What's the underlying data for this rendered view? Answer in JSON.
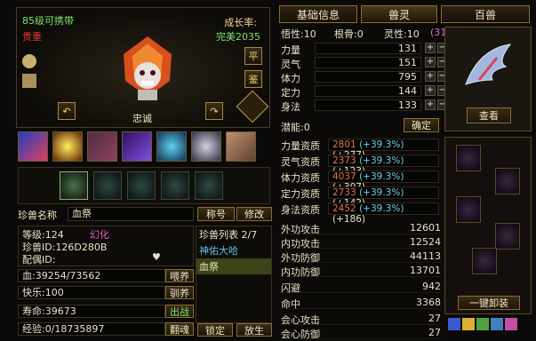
{
  "pet": {
    "level_text": "85级可携带",
    "rarity": "贵重",
    "growth_label": "成长率:",
    "growth_value": "完美2035",
    "loyalty": "忠诚",
    "btn_ping": "平",
    "btn_jian": "鉴"
  },
  "name_row": {
    "label": "珍兽名称",
    "value": "血祭",
    "btn_title": "称号",
    "btn_edit": "修改"
  },
  "info": {
    "level": "等级:124",
    "transform": "幻化",
    "pet_id": "珍兽ID:126D280B",
    "mate_id": "配偶ID:"
  },
  "pet_list": {
    "header": "珍兽列表 2/7",
    "items": [
      "神佑大哈",
      "血祭"
    ]
  },
  "bars": {
    "hp": "血:39254/73562",
    "hp_btn": "喂养",
    "happy": "快乐:100",
    "happy_btn": "驯养",
    "life": "寿命:39673",
    "life_btn": "出战",
    "exp": "经验:0/18735897",
    "exp_btn": "翻魂",
    "lock_btn": "锁定",
    "release_btn": "放生"
  },
  "tabs": [
    "基础信息",
    "兽灵",
    "百兽"
  ],
  "top_stats": {
    "wuxing": "悟性:10",
    "genu": "根骨:0",
    "lingxing": "灵性:10",
    "lingxing_pct": "(31.0%)"
  },
  "attrs": [
    {
      "label": "力量",
      "value": "131"
    },
    {
      "label": "灵气",
      "value": "151"
    },
    {
      "label": "体力",
      "value": "795"
    },
    {
      "label": "定力",
      "value": "144"
    },
    {
      "label": "身法",
      "value": "133"
    }
  ],
  "potential": "潜能:0",
  "confirm_btn": "确定",
  "aptitudes": [
    {
      "label": "力量资质",
      "base": "2801",
      "pct": "(+39.3%)",
      "bonus": "(+277)"
    },
    {
      "label": "灵气资质",
      "base": "2373",
      "pct": "(+39.3%)",
      "bonus": "(+123)"
    },
    {
      "label": "体力资质",
      "base": "4037",
      "pct": "(+39.3%)",
      "bonus": "(+307)"
    },
    {
      "label": "定力资质",
      "base": "2733",
      "pct": "(+39.3%)",
      "bonus": "(+142)"
    },
    {
      "label": "身法资质",
      "base": "2452",
      "pct": "(+39.3%)",
      "bonus": "(+186)"
    }
  ],
  "battle": [
    {
      "label": "外功攻击",
      "value": "12601"
    },
    {
      "label": "内功攻击",
      "value": "12524"
    },
    {
      "label": "外功防御",
      "value": "44113"
    },
    {
      "label": "内功防御",
      "value": "13701"
    },
    {
      "label": "闪避",
      "value": "942"
    },
    {
      "label": "命中",
      "value": "3368"
    },
    {
      "label": "会心攻击",
      "value": "27"
    },
    {
      "label": "会心防御",
      "value": "27"
    }
  ],
  "view_btn": "查看",
  "equip_btn": "一键卸装",
  "colors": {
    "gold": "#f0c850",
    "green": "#7de36a",
    "red": "#e03a2a",
    "cyan": "#6ad0e0",
    "pinkpct": "#d070e0"
  }
}
